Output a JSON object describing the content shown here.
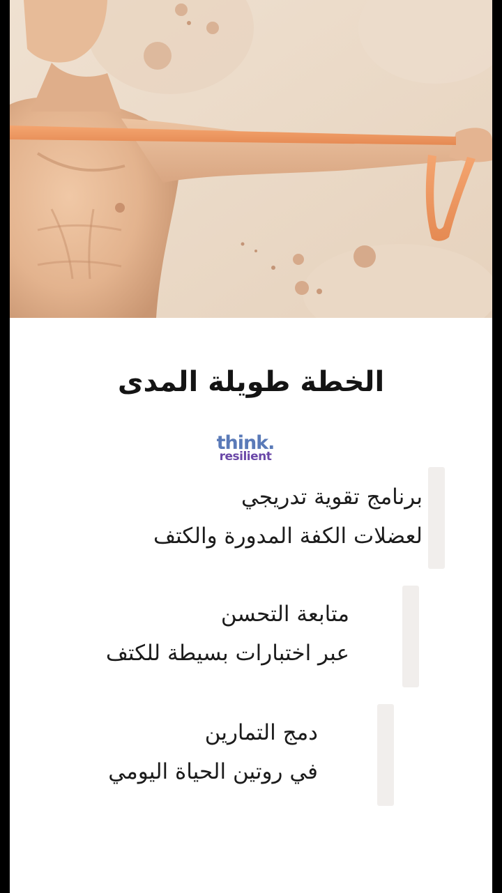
{
  "hero": {
    "image_description_icon": "man-stretching-resistance-band-illustration",
    "colors": {
      "background": "#ead9c7",
      "band": "#ee9a62",
      "skin": "#e5b792"
    }
  },
  "title": "الخطة طويلة المدى",
  "logo": {
    "line1": "think.",
    "line2": "resilient"
  },
  "items": [
    {
      "line1": "برنامج تقوية تدريجي",
      "line2": "لعضلات الكفة المدورة والكتف"
    },
    {
      "line1": "متابعة التحسن",
      "line2": "عبر اختبارات بسيطة للكتف"
    },
    {
      "line1": "دمج التمارين",
      "line2": "في روتين الحياة اليومي"
    }
  ]
}
